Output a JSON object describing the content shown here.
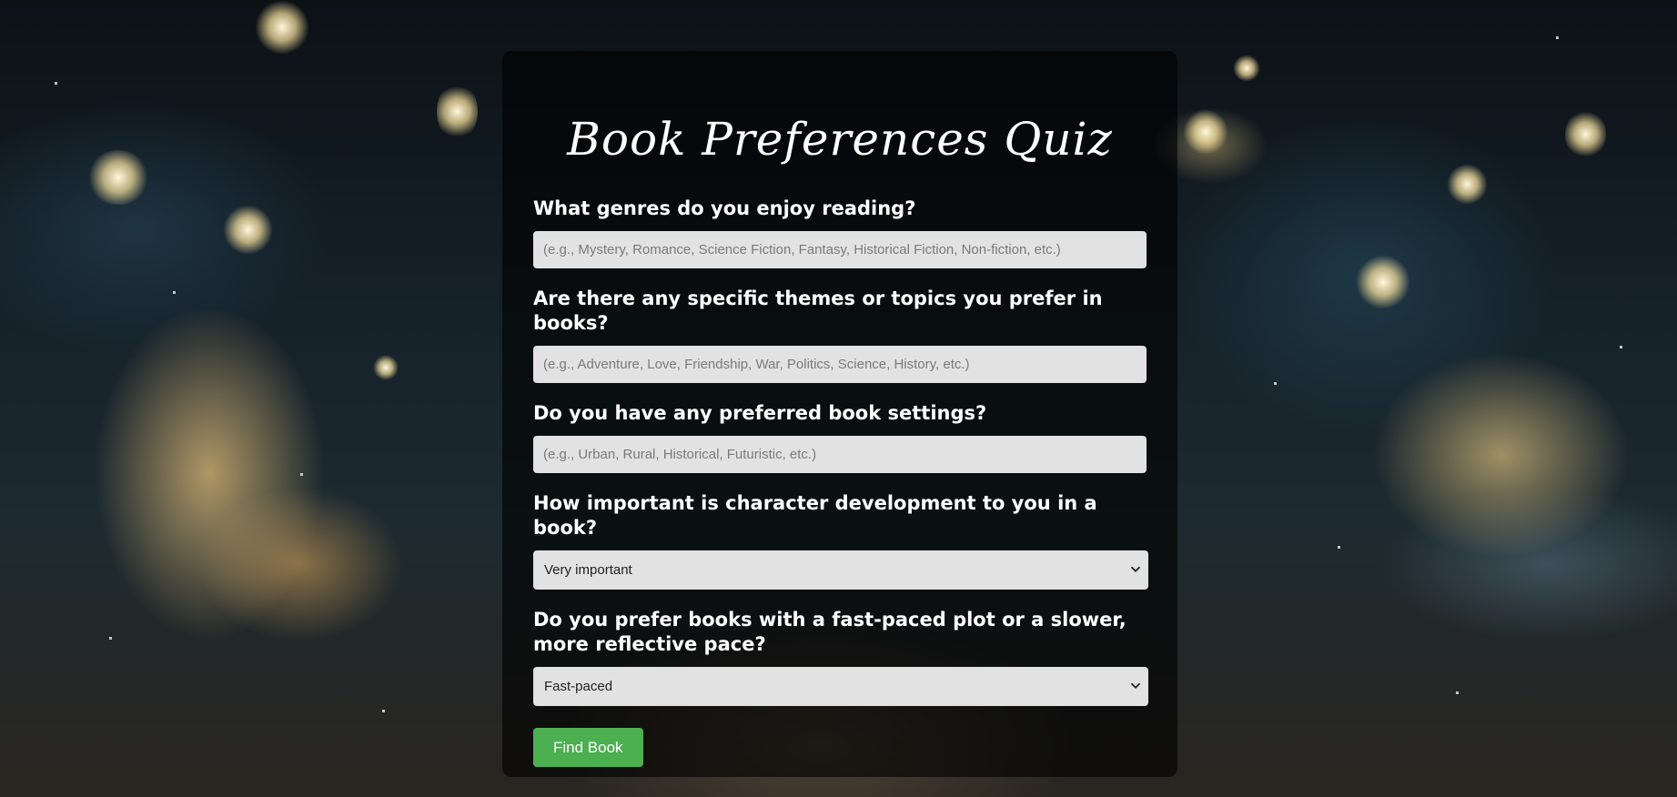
{
  "quiz": {
    "title": "Book Preferences Quiz",
    "questions": [
      {
        "label": "What genres do you enjoy reading?",
        "type": "text",
        "value": "",
        "placeholder": "(e.g., Mystery, Romance, Science Fiction, Fantasy, Historical Fiction, Non-fiction, etc.)"
      },
      {
        "label": "Are there any specific themes or topics you prefer in books?",
        "type": "text",
        "value": "",
        "placeholder": "(e.g., Adventure, Love, Friendship, War, Politics, Science, History, etc.)"
      },
      {
        "label": "Do you have any preferred book settings?",
        "type": "text",
        "value": "",
        "placeholder": "(e.g., Urban, Rural, Historical, Futuristic, etc.)"
      },
      {
        "label": "How important is character development to you in a book?",
        "type": "select",
        "selected": "Very important"
      },
      {
        "label": "Do you prefer books with a fast-paced plot or a slower, more reflective pace?",
        "type": "select",
        "selected": "Fast-paced"
      }
    ],
    "submit_label": "Find Book",
    "colors": {
      "button": "#4caf50",
      "field_bg": "#e2e2e2",
      "panel": "rgba(0,0,0,0.62)"
    }
  },
  "background": {
    "description_icon": "starry-galaxy-background"
  }
}
